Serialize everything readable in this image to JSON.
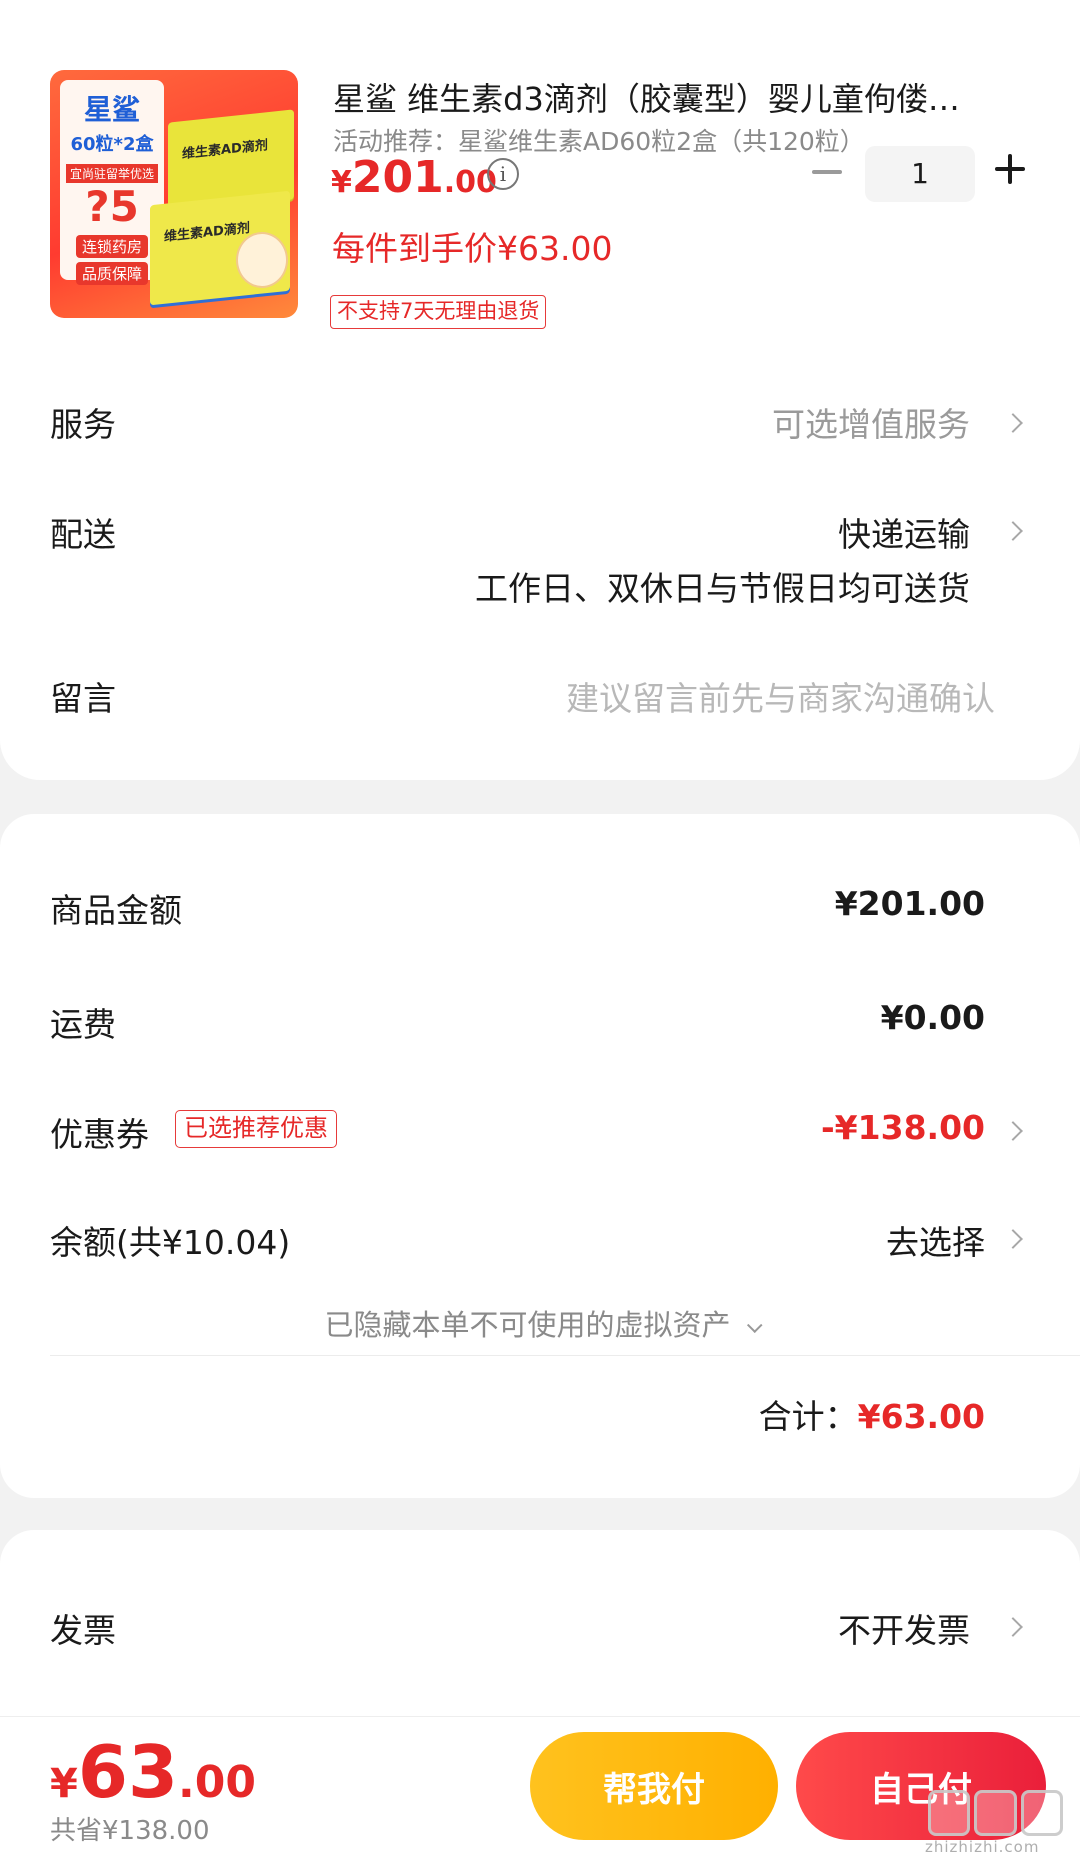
{
  "product": {
    "title": "星鲨 维生素d3滴剂（胶囊型）婴儿童佝偻…",
    "promo": "活动推荐：星鲨维生素AD60粒2盒（共120粒）",
    "price_currency": "¥",
    "price_int": "201",
    "price_dec": ".00",
    "unit_price": "每件到手价¥63.00",
    "return_tag": "不支持7天无理由退货",
    "quantity": "1",
    "thumb_brand": "星鲨",
    "thumb_spec": "60粒*2盒",
    "thumb_note": "宜尚驻留举优选",
    "thumb_price": "?5",
    "thumb_badge1": "连锁药房",
    "thumb_badge2": "品质保障",
    "thumb_box_label": "维生素AD滴剂"
  },
  "rows": {
    "service_label": "服务",
    "service_value": "可选增值服务",
    "delivery_label": "配送",
    "delivery_value": "快递运输",
    "delivery_note": "工作日、双休日与节假日均可送货",
    "message_label": "留言",
    "message_placeholder": "建议留言前先与商家沟通确认"
  },
  "summary": {
    "goods_label": "商品金额",
    "goods_value": "¥201.00",
    "shipping_label": "运费",
    "shipping_value": "¥0.00",
    "coupon_label": "优惠券",
    "coupon_tag": "已选推荐优惠",
    "coupon_value": "-¥138.00",
    "balance_label": "余额(共¥10.04)",
    "balance_value": "去选择",
    "hidden_note": "已隐藏本单不可使用的虚拟资产",
    "total_label": "合计：",
    "total_value": "¥63.00"
  },
  "invoice": {
    "label": "发票",
    "value": "不开发票"
  },
  "bottom": {
    "currency": "¥",
    "price_int": "63",
    "price_dec": ".00",
    "saved": "共省¥138.00",
    "help_pay": "帮我付",
    "self_pay": "自己付",
    "watermark": "zhizhizhi.com"
  },
  "colors": {
    "accent_red": "#e62828",
    "help_button": "#ffb000",
    "pay_button": "#ea1f3a"
  }
}
